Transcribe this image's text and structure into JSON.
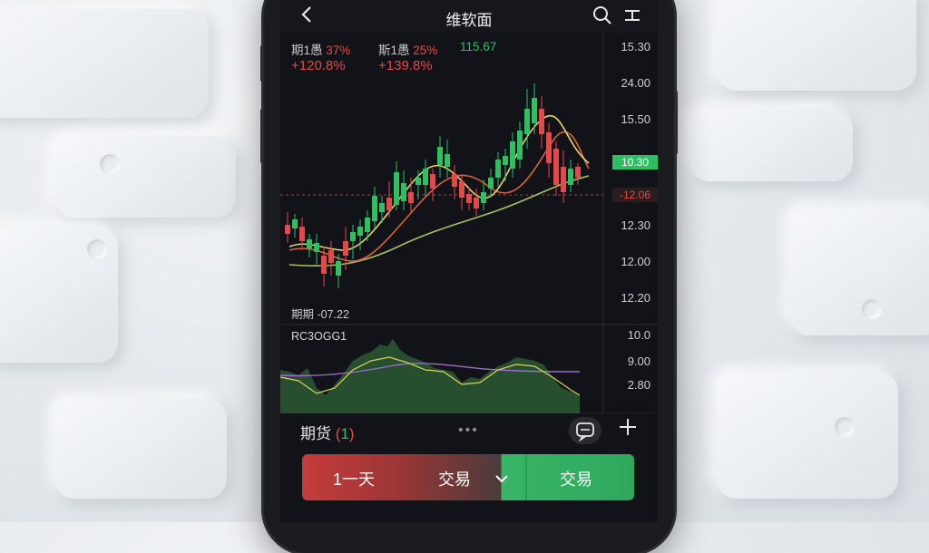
{
  "app": {
    "title": "维软面",
    "back_icon": "chevron-left-icon",
    "search_icon": "search-icon",
    "menu_icon": "menu-icon"
  },
  "stats": {
    "label1": "期1愚",
    "value1": "37%",
    "label2": "斯1愚",
    "value2": "25%",
    "value3": "115.67",
    "change1": "+120.8%",
    "change2": "+139.8%"
  },
  "price_axis": {
    "labels": [
      "15.30",
      "24.00",
      "15.50",
      "12.30",
      "12.00",
      "12.20"
    ]
  },
  "price_tags": {
    "current": "10.30",
    "reference": "-12.06"
  },
  "pnl_text": "期期 -07.22",
  "indicator": {
    "name": "RC3OGG1",
    "axis_labels": [
      "10.0",
      "9.00",
      "2.80"
    ]
  },
  "bottom": {
    "label_main": "期货",
    "label_paren_open": "(",
    "label_num": "1",
    "label_paren_close": ")",
    "dots": "•••",
    "chat_icon": "chat-bubble-icon",
    "plus_icon": "plus-icon"
  },
  "trade_bar": {
    "period": "1一天",
    "mode": "交易",
    "chevron_icon": "chevron-down-icon",
    "action": "交易"
  },
  "colors": {
    "up": "#2fbf63",
    "down": "#e24a4a",
    "ma_fast": "#e6d46a",
    "ma_mid": "#d9623b",
    "ma_slow": "#a8c25a"
  }
}
